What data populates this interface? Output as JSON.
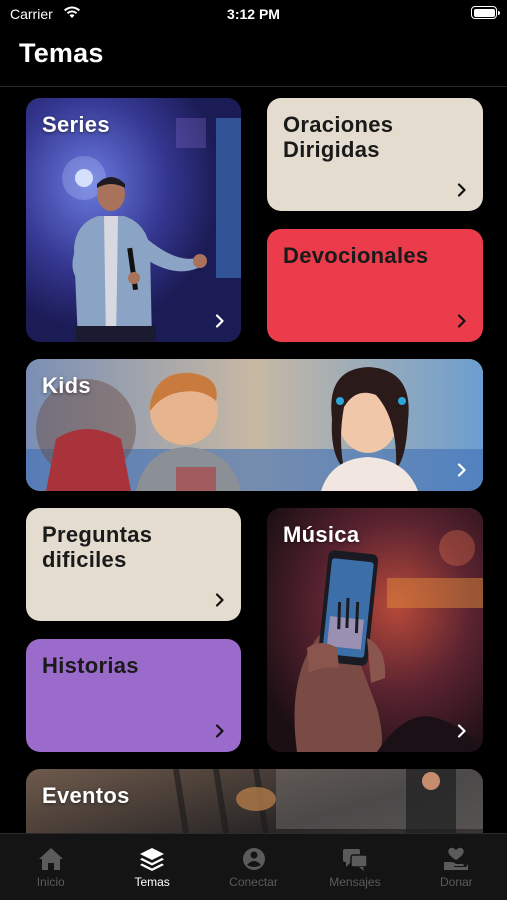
{
  "status_bar": {
    "carrier": "Carrier",
    "time": "3:12 PM"
  },
  "header": {
    "title": "Temas"
  },
  "cards": {
    "series": {
      "title": "Series",
      "bg": "#3b3a8c"
    },
    "oraciones": {
      "title": "Oraciones\nDirigidas",
      "bg": "#e3dccf"
    },
    "devocionales": {
      "title": "Devocionales",
      "bg": "#ec3c4c"
    },
    "kids": {
      "title": "Kids"
    },
    "preguntas": {
      "title": "Preguntas\ndificiles",
      "bg": "#e3dccf"
    },
    "musica": {
      "title": "Música"
    },
    "historias": {
      "title": "Historias",
      "bg": "#9b6bcb"
    },
    "eventos": {
      "title": "Eventos"
    }
  },
  "tab_bar": {
    "tabs": [
      {
        "label": "Inicio",
        "icon": "home-icon",
        "active": false
      },
      {
        "label": "Temas",
        "icon": "layers-icon",
        "active": true
      },
      {
        "label": "Conectar",
        "icon": "connect-icon",
        "active": false
      },
      {
        "label": "Mensajes",
        "icon": "messages-icon",
        "active": false
      },
      {
        "label": "Donar",
        "icon": "donate-icon",
        "active": false
      }
    ]
  }
}
